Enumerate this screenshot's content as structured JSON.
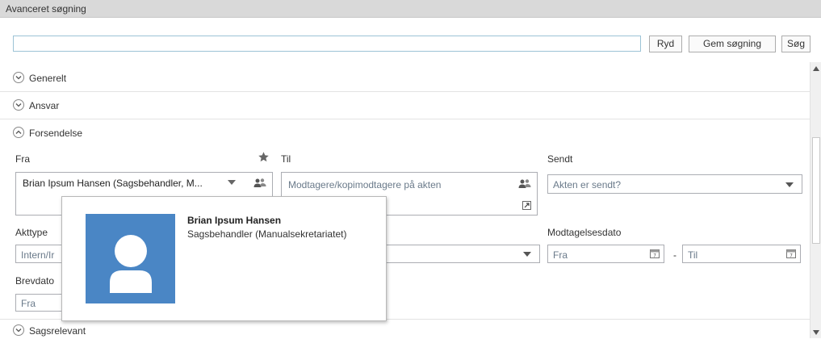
{
  "window": {
    "title": "Avanceret søgning"
  },
  "search": {
    "value": "",
    "placeholder": ""
  },
  "toolbar": {
    "clear_label": "Ryd",
    "save_label": "Gem søgning",
    "search_label": "Søg"
  },
  "sections": {
    "generelt": {
      "label": "Generelt",
      "expanded": false
    },
    "ansvar": {
      "label": "Ansvar",
      "expanded": false
    },
    "forsendelse": {
      "label": "Forsendelse",
      "expanded": true
    },
    "sagsrelevant": {
      "label": "Sagsrelevant",
      "expanded": false
    }
  },
  "forsendelse": {
    "fra_label": "Fra",
    "fra_value": "Brian Ipsum Hansen (Sagsbehandler, M...",
    "til_label": "Til",
    "til_placeholder": "Modtagere/kopimodtagere på akten",
    "sendt_label": "Sendt",
    "sendt_placeholder": "Akten er sendt?",
    "akttype_label": "Akttype",
    "akttype_placeholder": "Intern/Ir",
    "modtagelsesdato_label": "Modtagelsesdato",
    "modtagelsesdato_from": "Fra",
    "modtagelsesdato_sep": "-",
    "modtagelsesdato_to": "Til",
    "brevdato_label": "Brevdato",
    "brevdato_from": "Fra"
  },
  "popup": {
    "name": "Brian Ipsum Hansen",
    "role": "Sagsbehandler (Manualsekretariatet)"
  },
  "icons": {
    "favorite": "star-icon",
    "people": "people-icon",
    "calendar": "calendar-icon",
    "expand": "expand-icon"
  },
  "colors": {
    "accent": "#4a86c5",
    "titlebar": "#d9d9d9",
    "field_border": "#abadb3"
  }
}
